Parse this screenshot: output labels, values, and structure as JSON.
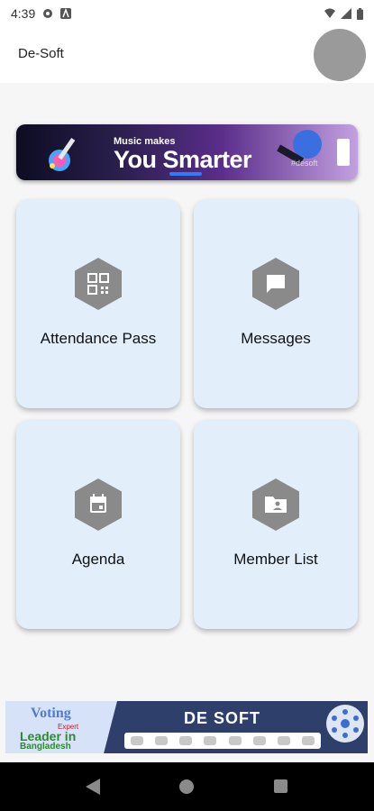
{
  "status_bar": {
    "time": "4:39",
    "left_icons": [
      "sync-icon",
      "font-icon"
    ],
    "right_icons": [
      "wifi-icon",
      "signal-icon",
      "battery-icon"
    ]
  },
  "app_bar": {
    "title": "De-Soft"
  },
  "top_banner": {
    "line1": "Music makes",
    "line2": "You Smarter",
    "tag": "#desoft"
  },
  "tiles": [
    {
      "label": "Attendance Pass",
      "icon": "qr-code-icon"
    },
    {
      "label": "Messages",
      "icon": "message-icon"
    },
    {
      "label": "Agenda",
      "icon": "calendar-icon"
    },
    {
      "label": "Member List",
      "icon": "contacts-folder-icon"
    }
  ],
  "footer_banner": {
    "voting": "Voting",
    "expert": "Expert",
    "leader": "Leader in",
    "country": "Bangladesh",
    "title": "DE SOFT"
  },
  "colors": {
    "tile_bg": "#e2effb",
    "hex_icon": "#8a8a8a",
    "avatar": "#9a9a9a",
    "nav_bar": "#000000"
  }
}
